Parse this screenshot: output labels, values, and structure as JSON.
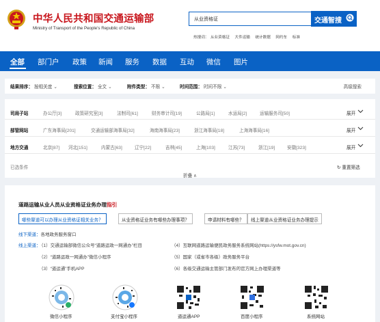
{
  "header": {
    "title": "中华人民共和国交通运输部",
    "subtitle": "Ministry of Transport of the People's Republic of China",
    "search_value": "从业资格证",
    "search_button": "交通智搜",
    "hot_label": "热搜词：",
    "hot_terms": [
      "从业资格证",
      "大件运输",
      "统计数据",
      "网约车",
      "标准"
    ]
  },
  "nav": {
    "items": [
      "全部",
      "部门户",
      "政策",
      "新闻",
      "服务",
      "数据",
      "互动",
      "微信",
      "图片"
    ]
  },
  "filters": {
    "sort_label": "结果排序：",
    "sort_value": "按相关度",
    "position_label": "搜索位置：",
    "position_value": "全文",
    "attach_label": "附件类型：",
    "attach_value": "不限",
    "time_label": "时间范围：",
    "time_value": "时间不限",
    "advanced": "高级搜索"
  },
  "facets": {
    "rows": [
      {
        "label": "司局子站",
        "values": [
          "办公厅[3]",
          "政策研究室[3]",
          "法制司[61]",
          "财务审计司[19]",
          "公路局[1]",
          "水运局[2]",
          "运输服务司[50]"
        ]
      },
      {
        "label": "部管网站",
        "values": [
          "广东海事局[201]",
          "交通运输部海事局[32]",
          "海南海事局[23]",
          "浙江海事局[18]",
          "上海海事局[16]"
        ]
      },
      {
        "label": "地方交通",
        "values": [
          "北京[87]",
          "河北[151]",
          "内蒙古[63]",
          "辽宁[22]",
          "吉林[45]",
          "上海[103]",
          "江苏[73]",
          "浙江[19]",
          "安徽[323]"
        ]
      }
    ],
    "expand": "展开",
    "selected": "已选条件",
    "reset": "重置筛选",
    "collapse": "折叠 ∧"
  },
  "guide": {
    "title_main": "道路运输从业人员从业资格证业务办理",
    "title_red": "指引",
    "tabs": [
      "哪些渠道可以办理从业资格证相关业务？",
      "从业资格证业务有哪些办理事项？",
      "申请材料有哪些？",
      "线上渠道从业资格证业务办理提示"
    ],
    "offline_label": "线下渠道：",
    "offline_text": "各地政务服务窗口",
    "online_label": "线上渠道：",
    "left_items": [
      "（1）交通运输部微信公众号“道路运政一网通办”栏目",
      "（2）“道路运政一网通办”微信小程序",
      "（3）“道运通”手机APP"
    ],
    "right_items": [
      "（4）互联网道路运输便民政务服务系统网站(https://ysfw.mot.gov.cn)",
      "（5）国家（或省市各级）政务服务平台",
      "（6）各级交通运输主管部门发布的官方网上办理渠道等"
    ],
    "qr_labels": [
      "微信小程序",
      "支付宝小程序",
      "道运通APP",
      "百度小程序",
      "系统网站"
    ]
  },
  "colors": {
    "brand_blue": "#0a62c5",
    "brand_red": "#c8161d"
  }
}
